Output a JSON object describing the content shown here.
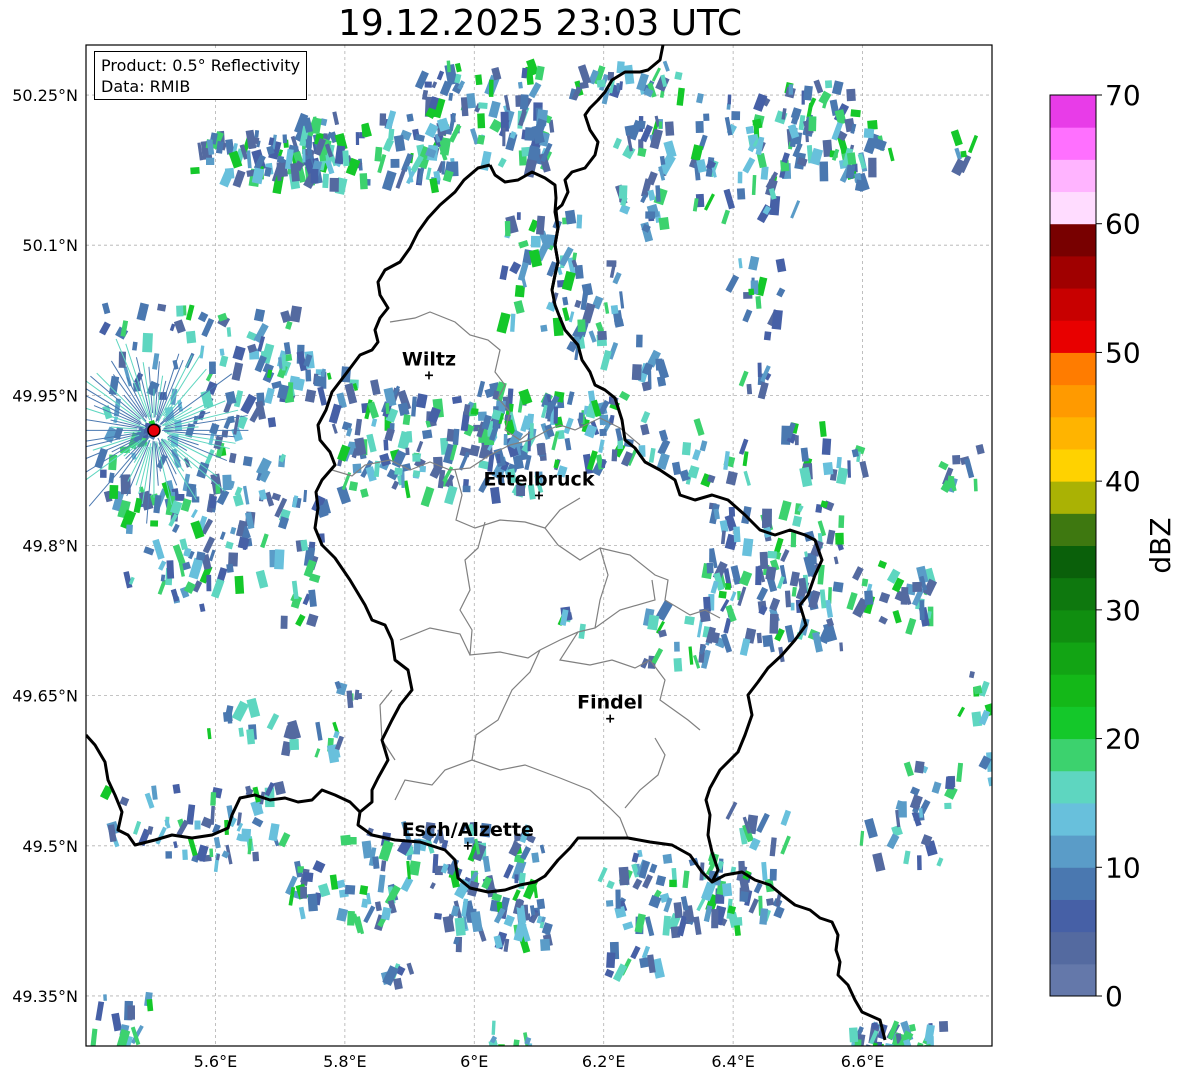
{
  "title": "19.12.2025 23:03 UTC",
  "info": {
    "product": "Product: 0.5° Reflectivity",
    "data_source": "Data: RMIB"
  },
  "map": {
    "lon_range": [
      5.4,
      6.8
    ],
    "lat_range": [
      49.3,
      50.3
    ],
    "lon_ticks": [
      {
        "value": 5.6,
        "label": "5.6°E"
      },
      {
        "value": 5.8,
        "label": "5.8°E"
      },
      {
        "value": 6.0,
        "label": "6°E"
      },
      {
        "value": 6.2,
        "label": "6.2°E"
      },
      {
        "value": 6.4,
        "label": "6.4°E"
      },
      {
        "value": 6.6,
        "label": "6.6°E"
      }
    ],
    "lat_ticks": [
      {
        "value": 50.25,
        "label": "50.25°N"
      },
      {
        "value": 50.1,
        "label": "50.1°N"
      },
      {
        "value": 49.95,
        "label": "49.95°N"
      },
      {
        "value": 49.8,
        "label": "49.8°N"
      },
      {
        "value": 49.65,
        "label": "49.65°N"
      },
      {
        "value": 49.5,
        "label": "49.5°N"
      },
      {
        "value": 49.35,
        "label": "49.35°N"
      }
    ],
    "grid": true,
    "cities": [
      {
        "name": "Wiltz",
        "lon": 5.93,
        "lat": 49.97
      },
      {
        "name": "Ettelbruck",
        "lon": 6.1,
        "lat": 49.85
      },
      {
        "name": "Findel",
        "lon": 6.21,
        "lat": 49.627
      },
      {
        "name": "Esch/Alzette",
        "lon": 5.99,
        "lat": 49.5
      }
    ],
    "radar_site": {
      "lon": 5.505,
      "lat": 49.915,
      "color": "#e8000b"
    }
  },
  "colorbar": {
    "label": "dBZ",
    "min": 0,
    "max": 70,
    "step": 2.5,
    "ticks": [
      {
        "value": 0,
        "label": "0"
      },
      {
        "value": 10,
        "label": "10"
      },
      {
        "value": 20,
        "label": "20"
      },
      {
        "value": 30,
        "label": "30"
      },
      {
        "value": 40,
        "label": "40"
      },
      {
        "value": 50,
        "label": "50"
      },
      {
        "value": 60,
        "label": "60"
      },
      {
        "value": 70,
        "label": "70"
      }
    ],
    "colors": [
      "#6478aa",
      "#546aa0",
      "#4660a6",
      "#4a78b0",
      "#5a9cc8",
      "#68c0dc",
      "#5ed6c0",
      "#3cd26e",
      "#14c82a",
      "#14b818",
      "#12a414",
      "#108e10",
      "#0e780e",
      "#0a600a",
      "#3e7810",
      "#aab204",
      "#ffd200",
      "#ffb400",
      "#ff9a00",
      "#ff7c00",
      "#e80000",
      "#c80000",
      "#a00000",
      "#780000",
      "#ffdcff",
      "#ffb4ff",
      "#ff70ff",
      "#e83ce8"
    ]
  }
}
